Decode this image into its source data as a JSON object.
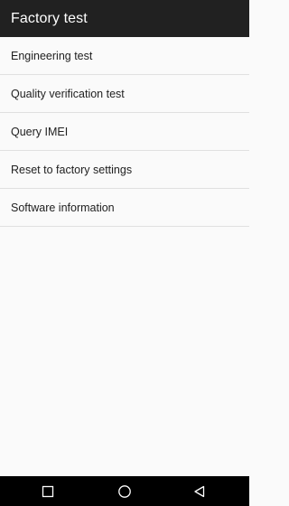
{
  "app_bar": {
    "title": "Factory test"
  },
  "menu": {
    "items": [
      {
        "label": "Engineering test"
      },
      {
        "label": "Quality verification test"
      },
      {
        "label": "Query IMEI"
      },
      {
        "label": "Reset to factory settings"
      },
      {
        "label": "Software information"
      }
    ]
  },
  "nav_bar": {
    "buttons": [
      {
        "icon": "recents-square-icon"
      },
      {
        "icon": "home-circle-icon"
      },
      {
        "icon": "back-triangle-icon"
      }
    ]
  },
  "colors": {
    "app_bar_bg": "#212121",
    "app_bar_text": "#ffffff",
    "background": "#fafafa",
    "divider": "#e0e0e0",
    "nav_bar_bg": "#000000"
  }
}
